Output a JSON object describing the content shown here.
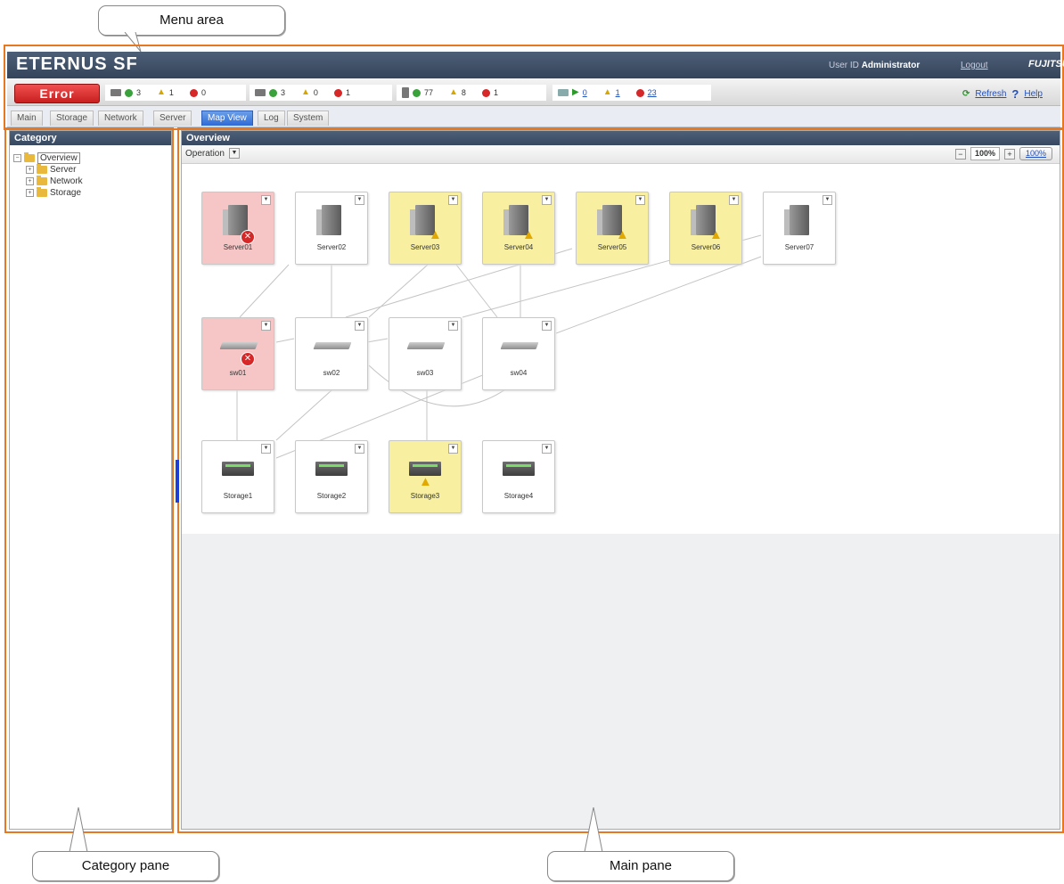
{
  "callouts": {
    "menu_area": "Menu area",
    "category_pane": "Category pane",
    "main_pane": "Main pane"
  },
  "header": {
    "logo": "ETERNUS SF",
    "user_id_label": "User ID",
    "user_name": "Administrator",
    "logout": "Logout",
    "brand": "FUJITSU"
  },
  "status": {
    "error_label": "Error",
    "servers": {
      "ok": "3",
      "warning": "1",
      "error": "0"
    },
    "switches": {
      "ok": "3",
      "warning": "0",
      "error": "1"
    },
    "storage": {
      "ok": "77",
      "warning": "8",
      "error": "1"
    },
    "tasks": {
      "running": "0",
      "warning": "1",
      "error": "23"
    },
    "refresh": "Refresh",
    "help": "Help"
  },
  "tabs": [
    "Main",
    "Storage",
    "Network",
    "Server",
    "Map View",
    "Log",
    "System"
  ],
  "active_tab": "Map View",
  "category": {
    "title": "Category",
    "root": "Overview",
    "children": [
      "Server",
      "Network",
      "Storage"
    ]
  },
  "main": {
    "title": "Overview",
    "operation": "Operation",
    "zoom_value": "100%",
    "zoom_reset": "100%"
  },
  "map": {
    "servers": [
      {
        "label": "Server01",
        "status": "error"
      },
      {
        "label": "Server02",
        "status": "normal"
      },
      {
        "label": "Server03",
        "status": "warning"
      },
      {
        "label": "Server04",
        "status": "warning"
      },
      {
        "label": "Server05",
        "status": "warning"
      },
      {
        "label": "Server06",
        "status": "warning"
      },
      {
        "label": "Server07",
        "status": "normal"
      }
    ],
    "switches": [
      {
        "label": "sw01",
        "status": "error"
      },
      {
        "label": "sw02",
        "status": "normal"
      },
      {
        "label": "sw03",
        "status": "normal"
      },
      {
        "label": "sw04",
        "status": "normal"
      }
    ],
    "storages": [
      {
        "label": "Storage1",
        "status": "normal"
      },
      {
        "label": "Storage2",
        "status": "normal"
      },
      {
        "label": "Storage3",
        "status": "warning"
      },
      {
        "label": "Storage4",
        "status": "normal"
      }
    ]
  }
}
